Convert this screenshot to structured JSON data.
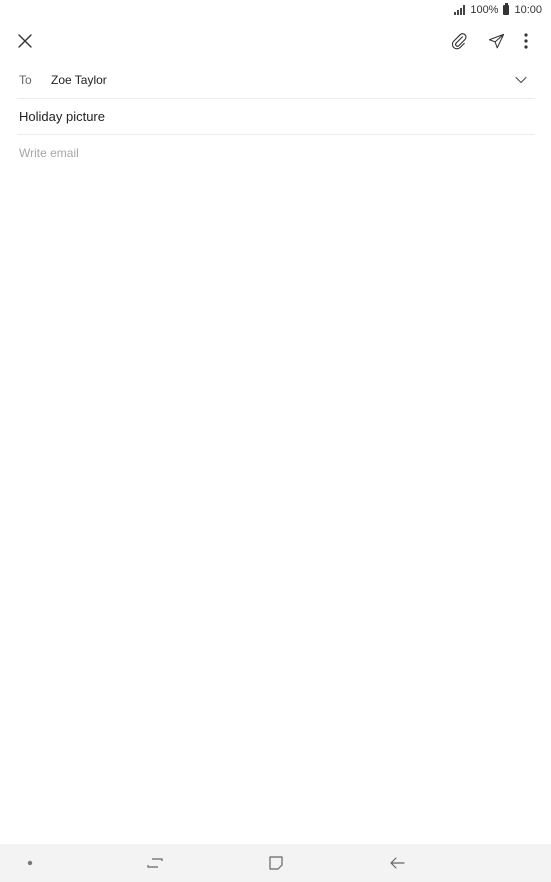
{
  "status_bar": {
    "battery_percent": "100%",
    "time": "10:00"
  },
  "toolbar": {
    "icons": [
      "close-icon",
      "paperclip-icon",
      "send-icon",
      "more-vert-icon"
    ]
  },
  "compose": {
    "to_label": "To",
    "to_value": "Zoe Taylor",
    "subject_value": "Holiday picture",
    "body_placeholder": "Write email"
  },
  "nav_bar": {
    "icons": [
      "dot-icon",
      "recent-apps-icon",
      "home-icon",
      "back-icon"
    ]
  }
}
